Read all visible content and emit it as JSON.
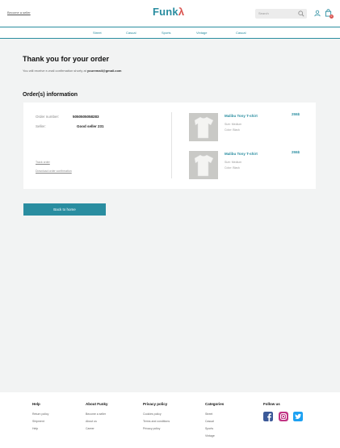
{
  "header": {
    "seller_link": "Become a seller",
    "logo_text": "Funk",
    "logo_mark": "λ",
    "search_placeholder": "Search",
    "cart_count": "0"
  },
  "nav": {
    "items": [
      "Street",
      "Casual",
      "Sports",
      "Vintage",
      "Casual"
    ]
  },
  "confirmation": {
    "title": "Thank you for your order",
    "message": "You will receive e-mail confirmation shorty at",
    "email": "youremail@gmail.com"
  },
  "orders": {
    "title": "Order(s) information",
    "order_number_label": "Order number:",
    "order_number": "5050505058283",
    "seller_label": "Seller:",
    "seller": "Good seller 231",
    "track_link": "Track order",
    "download_link": "Download order confirmation",
    "items": [
      {
        "name": "Malibu Tony T-shirt",
        "size": "Size: Medium",
        "color": "Color: Black",
        "price": "255$"
      },
      {
        "name": "Malibu Tony T-shirt",
        "size": "Size: Medium",
        "color": "Color: Black",
        "price": "255$"
      }
    ]
  },
  "back_button": "Back to home",
  "footer": {
    "columns": [
      {
        "title": "Help",
        "items": [
          "Return policy",
          "Shipment",
          "Help"
        ]
      },
      {
        "title": "About Funky",
        "items": [
          "Become a seller",
          "About us",
          "Career"
        ]
      },
      {
        "title": "Privacy policy",
        "items": [
          "Cookies policy",
          "Terms and conditions",
          "Privacy policy"
        ]
      },
      {
        "title": "Categories",
        "items": [
          "Street",
          "Casual",
          "Sports",
          "Vintage"
        ]
      }
    ],
    "follow_title": "Follow us"
  },
  "colors": {
    "accent": "#2a8da0",
    "logo_mark": "#d9534f",
    "facebook": "#3b5998",
    "instagram": "#c13584",
    "twitter": "#1da1f2"
  },
  "icons": [
    "search-icon",
    "user-icon",
    "cart-icon",
    "facebook-icon",
    "instagram-icon",
    "twitter-icon"
  ]
}
